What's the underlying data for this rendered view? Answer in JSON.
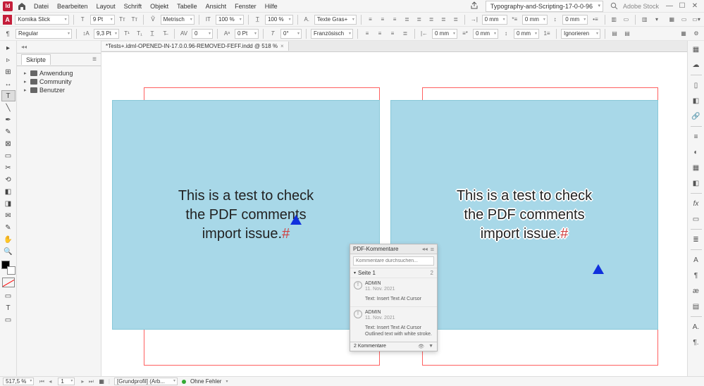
{
  "menu": {
    "items": [
      "Datei",
      "Bearbeiten",
      "Layout",
      "Schrift",
      "Objekt",
      "Tabelle",
      "Ansicht",
      "Fenster",
      "Hilfe"
    ]
  },
  "titlebar": {
    "docname": "Typography-and-Scripting-17-0-0-96",
    "stock": "Adobe Stock"
  },
  "font": {
    "family": "Komika Slick",
    "style": "Regular",
    "size": "9 Pt",
    "leading": "9,3 Pt",
    "metrics": "Metrisch",
    "tracking": "0",
    "vscale": "100 %",
    "hscale": "100 %",
    "baseline": "0 Pt",
    "skew": "0°",
    "charstyle": "Texte Gras+",
    "lang": "Französisch"
  },
  "spacing": {
    "v": [
      "0 mm",
      "0 mm",
      "0 mm",
      "0 mm"
    ],
    "ignore": "Ignorieren"
  },
  "scripts": {
    "title": "Skripte",
    "nodes": [
      "Anwendung",
      "Community",
      "Benutzer"
    ]
  },
  "doctab": {
    "label": "*Tests+.idml-OPENED-IN-17.0.0.96-REMOVED-FEFF.indd @ 518 %"
  },
  "textblock": {
    "line1": "This is a test to check",
    "line2": "the PDF comments",
    "line3": "import issue.",
    "hash": "#"
  },
  "pdfpanel": {
    "title": "PDF-Kommentare",
    "search_placeholder": "Kommentare durchsuchen...",
    "group": {
      "label": "Seite 1",
      "count": "2"
    },
    "comments": [
      {
        "author": "ADMIN",
        "date": "11. Nov. 2021",
        "body": "Text: Insert Text At Cursor"
      },
      {
        "author": "ADMIN",
        "date": "11. Nov. 2021",
        "body": "Text: Insert Text At Cursor\nOutlined text with white stroke."
      }
    ],
    "footer": "2 Kommentare"
  },
  "status": {
    "zoom": "517,5 %",
    "page": "1",
    "profile": "[Grundprofil] (Arb...",
    "errors": "Ohne Fehler"
  },
  "icons": {
    "T": "T"
  }
}
